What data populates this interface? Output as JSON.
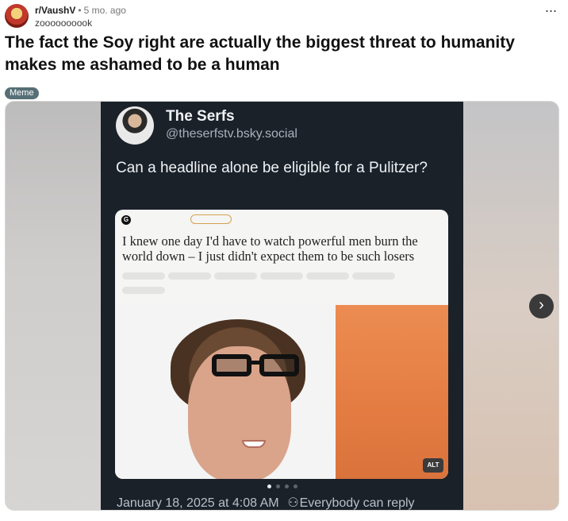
{
  "post": {
    "subreddit": "r/VaushV",
    "separator": "•",
    "age": "5 mo. ago",
    "author": "zoooooooook",
    "title": "The fact the Soy right are actually the biggest threat to humanity makes me ashamed to be a human",
    "flair": "Meme",
    "more_icon": "more-horizontal-icon"
  },
  "media": {
    "next_icon": "chevron-right-icon",
    "next_glyph": "›",
    "carousel": {
      "count": 4,
      "active_index": 1
    }
  },
  "tweet": {
    "name": "The Serfs",
    "handle": "@theserfstv.bsky.social",
    "text": "Can a headline alone be eligible for a Pulitzer?",
    "timestamp": "January 18, 2025 at 4:08 AM",
    "reply_icon": "people-icon",
    "reply_setting": "Everybody can reply"
  },
  "article": {
    "headline": "I knew one day I'd have to watch powerful men burn the world down – I just didn't expect them to be such losers",
    "alt_badge": "ALT"
  },
  "colors": {
    "flair_bg": "#576f76",
    "tweet_bg": "#1b2129",
    "photo_orange": "#e47c42"
  }
}
